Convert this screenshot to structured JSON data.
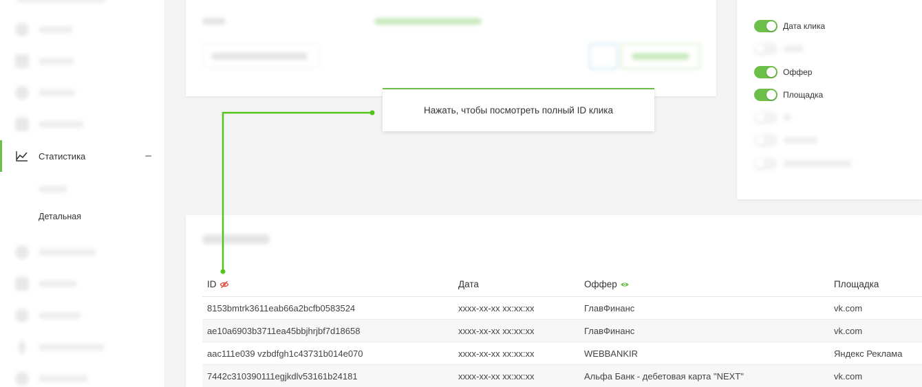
{
  "sidebar": {
    "active_item": {
      "label": "Статистика",
      "collapse_glyph": "–",
      "icon": "chart-line-icon"
    },
    "sub_items": [
      {
        "label": "Детальная"
      }
    ]
  },
  "columns_panel": {
    "toggles": [
      {
        "label": "Дата клика",
        "on": true
      },
      {
        "label": "Оффер",
        "on": true
      },
      {
        "label": "Площадка",
        "on": true
      }
    ]
  },
  "tooltip": {
    "text": "Нажать, чтобы посмотреть полный ID клика"
  },
  "table": {
    "headers": {
      "id": "ID",
      "date": "Дата",
      "offer": "Оффер",
      "platform": "Площадка"
    },
    "rows": [
      {
        "id": "8153bmtrk3611eab66a2bcfb0583524",
        "date": "xxxx-xx-xx xx:xx:xx",
        "offer": "ГлавФинанс",
        "platform": "vk.com"
      },
      {
        "id": "ae10a6903b3711ea45bbjhrjbf7d18658",
        "date": "xxxx-xx-xx xx:xx:xx",
        "offer": "ГлавФинанс",
        "platform": "vk.com"
      },
      {
        "id": "aac111e039 vzbdfgh1c43731b014e070",
        "date": "xxxx-xx-xx xx:xx:xx",
        "offer": "WEBBANKIR",
        "platform": "Яндекс Реклама"
      },
      {
        "id": "7442c310390111egjkdlv53161b24181",
        "date": "xxxx-xx-xx xx:xx:xx",
        "offer": "Альфа Банк - дебетовая карта \"NEXT\"",
        "platform": "vk.com"
      }
    ]
  },
  "colors": {
    "accent": "#6cc04a",
    "hidden_eye": "#e04a3c",
    "visible_eye": "#6cc04a"
  }
}
